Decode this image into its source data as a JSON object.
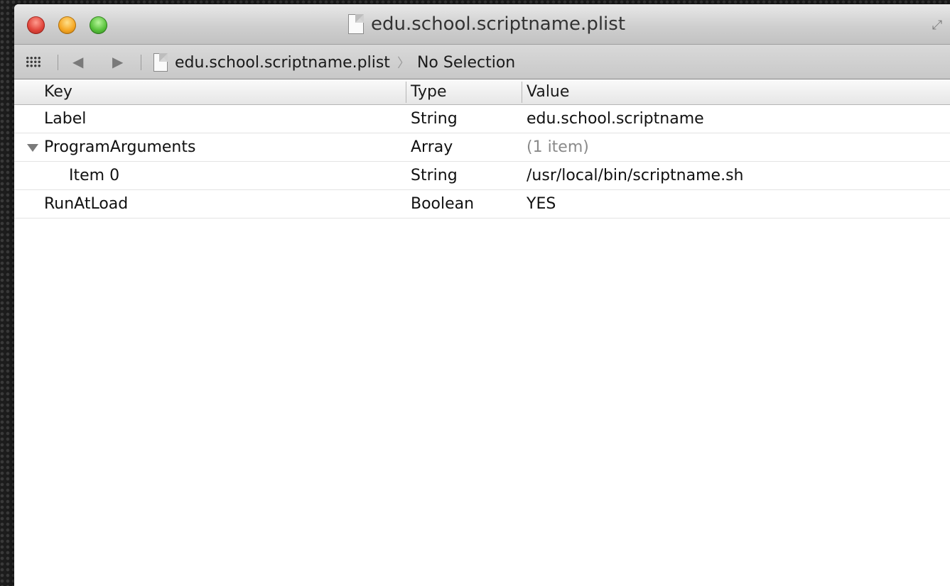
{
  "window": {
    "title": "edu.school.scriptname.plist"
  },
  "jumpbar": {
    "file": "edu.school.scriptname.plist",
    "selection": "No Selection"
  },
  "columns": {
    "key": "Key",
    "type": "Type",
    "value": "Value"
  },
  "rows": [
    {
      "key": "Label",
      "type": "String",
      "value": "edu.school.scriptname"
    },
    {
      "key": "ProgramArguments",
      "type": "Array",
      "value": "(1 item)",
      "expanded": true
    },
    {
      "key": "Item 0",
      "type": "String",
      "value": "/usr/local/bin/scriptname.sh",
      "level": 1
    },
    {
      "key": "RunAtLoad",
      "type": "Boolean",
      "value": "YES"
    }
  ],
  "icons": {
    "close": "close-button",
    "minimize": "minimize-button",
    "zoom": "zoom-button",
    "fullscreen": "fullscreen-icon",
    "grid": "related-items-grid-icon",
    "back": "back-arrow-icon",
    "forward": "forward-arrow-icon",
    "document": "document-icon",
    "disclosure": "disclosure-triangle-icon"
  }
}
